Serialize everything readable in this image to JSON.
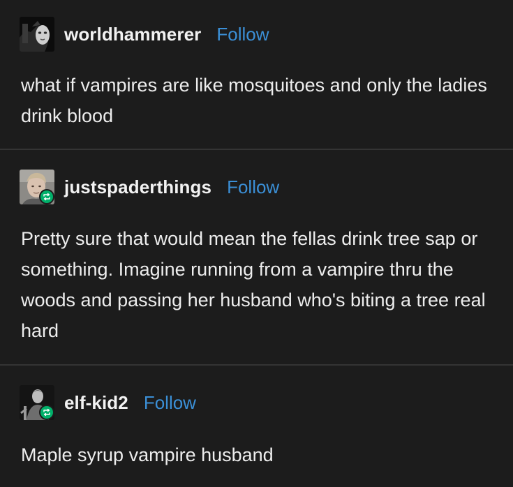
{
  "posts": [
    {
      "username": "worldhammerer",
      "follow_label": "Follow",
      "avatar_icon": "masked-figure-avatar",
      "reblog": false,
      "body": "what if vampires are like mosquitoes and only the ladies drink blood"
    },
    {
      "username": "justspaderthings",
      "follow_label": "Follow",
      "avatar_icon": "portrait-avatar",
      "reblog": true,
      "body": "Pretty sure that would mean the fellas drink tree sap or something. Imagine running from a vampire thru the woods and passing her husband who's biting a tree real hard"
    },
    {
      "username": "elf-kid2",
      "follow_label": "Follow",
      "avatar_icon": "figure-avatar",
      "reblog": true,
      "body": "Maple syrup vampire husband"
    }
  ],
  "colors": {
    "background": "#1c1c1c",
    "text": "#ededed",
    "follow": "#3b8fd6",
    "reblog_badge": "#01b06a",
    "divider": "#343434"
  }
}
